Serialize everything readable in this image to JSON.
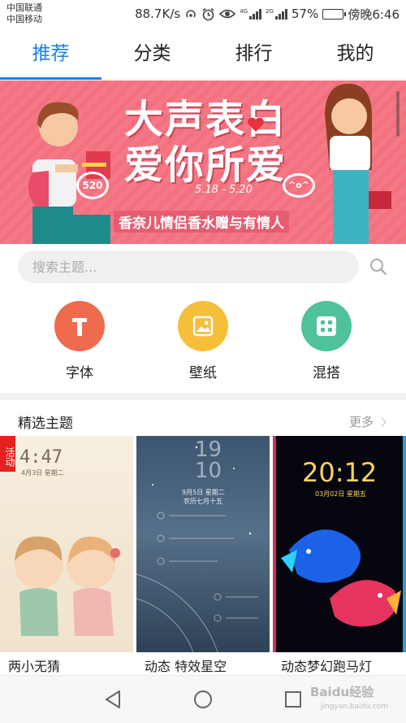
{
  "status_bar": {
    "carrier1": "中国联通",
    "carrier2": "中国移动",
    "speed": "88.7K/s",
    "net1": "4G",
    "net2": "2G",
    "battery_pct": "57%",
    "battery_level": 0.57,
    "time": "傍晚6:46"
  },
  "tabs": [
    {
      "label": "推荐",
      "active": true
    },
    {
      "label": "分类",
      "active": false
    },
    {
      "label": "排行",
      "active": false
    },
    {
      "label": "我的",
      "active": false
    }
  ],
  "banner": {
    "headline_line1": "大声表白",
    "headline_line2": "爱你所爱",
    "dates": "5.18 - 5.20",
    "subtitle": "香奈儿情侣香水赠与有情人",
    "bubble_left": "520",
    "bubble_right": "^o^",
    "page_count": 6,
    "active_page": 1
  },
  "search": {
    "placeholder": "搜索主题..."
  },
  "categories": [
    {
      "label": "字体",
      "icon": "font-icon",
      "color": "#ee6b4d"
    },
    {
      "label": "壁纸",
      "icon": "image-icon",
      "color": "#f5bf3a"
    },
    {
      "label": "混搭",
      "icon": "dice-icon",
      "color": "#4fc29a"
    }
  ],
  "featured": {
    "title": "精选主题",
    "more": "更多",
    "themes": [
      {
        "name": "两小无猜",
        "badge": "活动",
        "clock": "4:47",
        "date": "4月3日 星期二"
      },
      {
        "name": "动态 特效星空",
        "clock_h": "19",
        "clock_m": "10",
        "date": "9月5日 星期二",
        "lunar": "农历七月十五"
      },
      {
        "name": "动态梦幻跑马灯",
        "clock": "20:12",
        "date": "03月02日 星期五"
      }
    ]
  },
  "watermark": {
    "text": "Baidu经验",
    "sub": "jingyan.baidu.com"
  }
}
